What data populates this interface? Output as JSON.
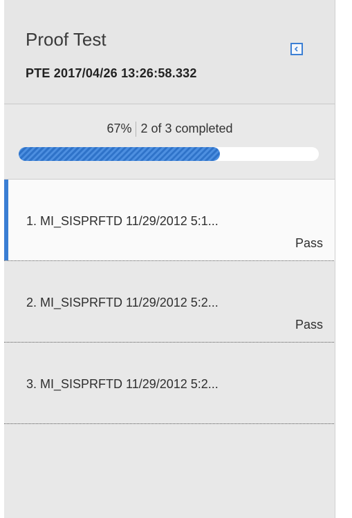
{
  "header": {
    "title": "Proof Test",
    "subtitle": "PTE 2017/04/26 13:26:58.332",
    "collapse_icon": "chevron-left-icon"
  },
  "progress": {
    "percent_label": "67%",
    "count_label": "2 of 3 completed",
    "fraction": 0.67,
    "bar_color": "#2f73c9"
  },
  "items": [
    {
      "label": "1. MI_SISPRFTD 11/29/2012 5:1...",
      "status": "Pass",
      "selected": true
    },
    {
      "label": "2. MI_SISPRFTD 11/29/2012 5:2...",
      "status": "Pass",
      "selected": false
    },
    {
      "label": "3. MI_SISPRFTD 11/29/2012 5:2...",
      "status": "",
      "selected": false
    }
  ],
  "colors": {
    "accent": "#3b7fd4",
    "panel_bg": "#e8e8e8"
  }
}
